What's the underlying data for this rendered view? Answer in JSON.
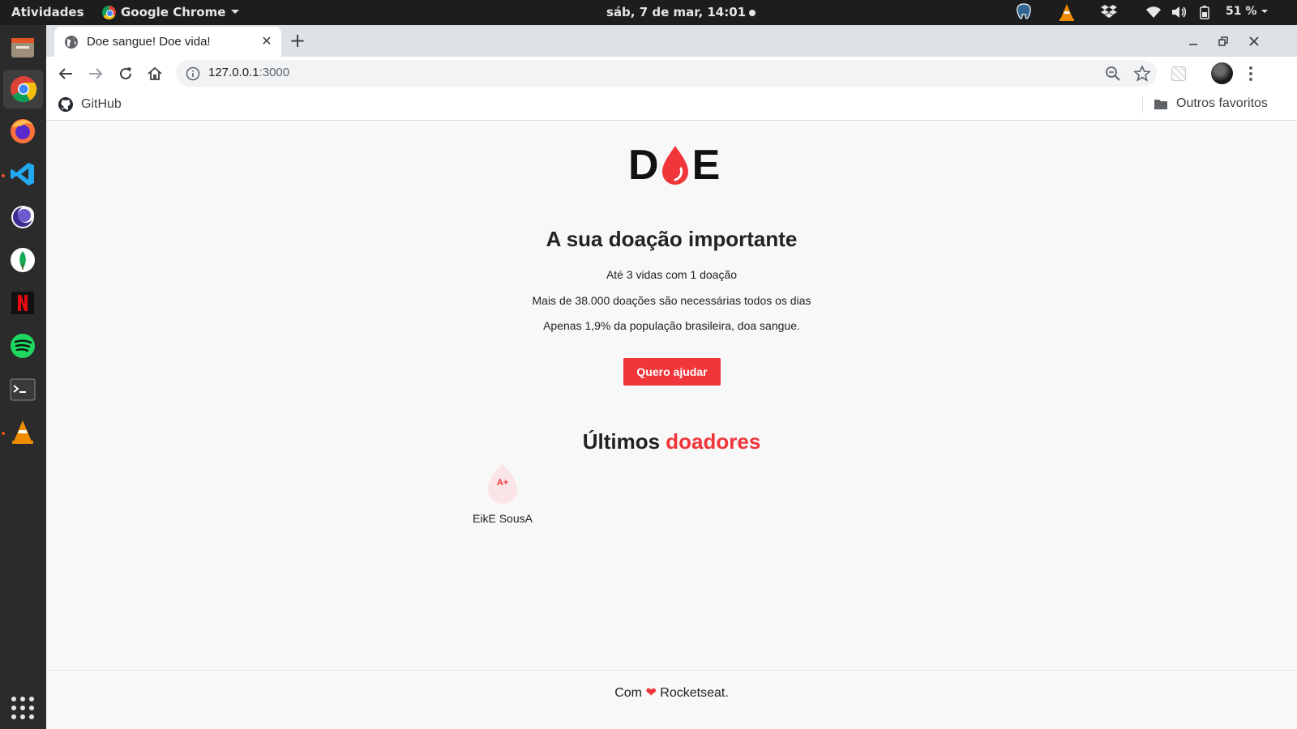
{
  "os": {
    "activities": "Atividades",
    "app_name": "Google Chrome",
    "clock": "sáb,  7 de mar, 14:01",
    "battery": "51 %",
    "tray_icons": [
      "postgres-icon",
      "vlc-icon",
      "dropbox-icon",
      "wifi-icon",
      "volume-icon",
      "battery-icon"
    ]
  },
  "dock": {
    "items": [
      "files",
      "chrome",
      "firefox",
      "vscode",
      "eclipse",
      "mongodb-compass",
      "netflix",
      "spotify",
      "terminal",
      "vlc"
    ],
    "active": "chrome"
  },
  "browser": {
    "tab_title": "Doe sangue! Doe vida!",
    "url_host": "127.0.0.1",
    "url_port": ":3000",
    "bookmarks": [
      {
        "label": "GitHub"
      }
    ],
    "other_bookmarks": "Outros favoritos"
  },
  "page": {
    "logo_left": "D",
    "logo_right": "E",
    "hero_title": "A sua doação importante",
    "lines": [
      "Até 3 vidas com 1 doação",
      "Mais de 38.000 doações são necessárias todos os dias",
      "Apenas 1,9% da população brasileira, doa sangue."
    ],
    "cta_label": "Quero ajudar",
    "donors_title_plain": "Últimos",
    "donors_title_accent": "doadores",
    "donors": [
      {
        "blood_type": "A+",
        "name": "EikE SousA"
      }
    ],
    "footer_prefix": "Com",
    "footer_heart": "❤",
    "footer_suffix": "Rocketseat."
  },
  "colors": {
    "accent": "#f0353b",
    "page_bg": "#f8f8f8",
    "topbar_bg": "#1d1d1d",
    "dock_bg": "#2b2b2b",
    "tabstrip_bg": "#dee1e6"
  }
}
